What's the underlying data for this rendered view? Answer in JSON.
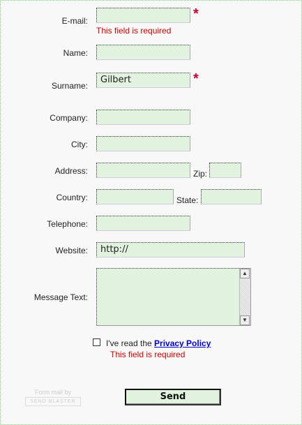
{
  "form": {
    "email_label": "E-mail:",
    "email_value": "",
    "email_error": "This field is required",
    "name_label": "Name:",
    "name_value": "",
    "surname_label": "Surname:",
    "surname_value": "Gilbert",
    "company_label": "Company:",
    "company_value": "",
    "city_label": "City:",
    "city_value": "",
    "address_label": "Address:",
    "address_value": "",
    "zip_label": "Zip:",
    "zip_value": "",
    "country_label": "Country:",
    "country_value": "",
    "state_label": "State:",
    "state_value": "",
    "telephone_label": "Telephone:",
    "telephone_value": "",
    "website_label": "Website:",
    "website_value": "http://",
    "message_label": "Message Text:",
    "message_value": "",
    "required_marker": "*",
    "privacy_text": "I've read the",
    "privacy_link": "Privacy Policy",
    "privacy_error": "This field is required",
    "send_label": "Send"
  },
  "footer": {
    "brand_line1": "Form mail by",
    "brand_line2": "SEND BLASTER"
  },
  "colors": {
    "input_bg": "#e2f3e0",
    "error": "#cc0000",
    "required": "#cc0033",
    "link": "#0000cc"
  }
}
